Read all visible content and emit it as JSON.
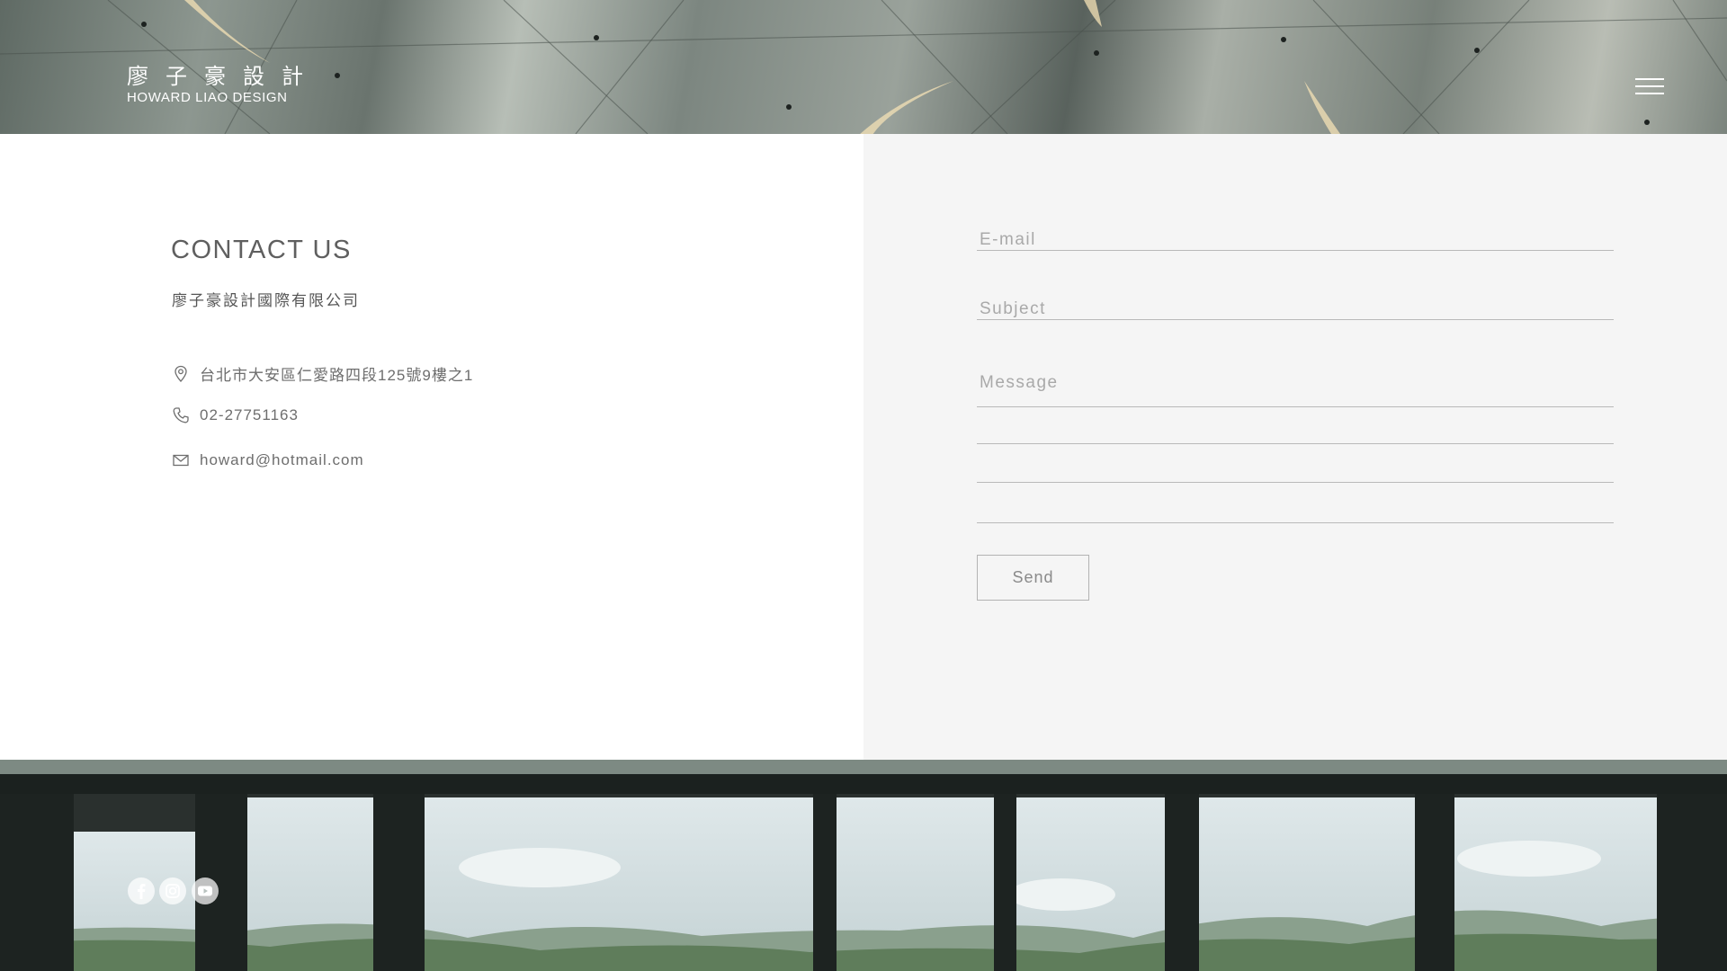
{
  "header": {
    "logo_cn": "廖子豪設計",
    "logo_en": "HOWARD LIAO DESIGN",
    "menu_icon": "hamburger-menu-icon"
  },
  "contact": {
    "title": "CONTACT US",
    "company": "廖子豪設計國際有限公司",
    "address": "台北市大安區仁愛路四段125號9樓之1",
    "phone": "02-27751163",
    "email": "howard@hotmail.com",
    "icons": [
      "map-pin-icon",
      "phone-icon",
      "mail-icon"
    ]
  },
  "form": {
    "email_placeholder": "E-mail",
    "subject_placeholder": "Subject",
    "message_placeholder": "Message",
    "send_label": "Send"
  },
  "footer": {
    "social_icons": [
      "facebook-icon",
      "instagram-icon",
      "youtube-icon"
    ]
  },
  "colors": {
    "panel_background": "#f5f5f5",
    "text_gray": "#5f5f5f",
    "line_gray": "#b9b9b9"
  }
}
